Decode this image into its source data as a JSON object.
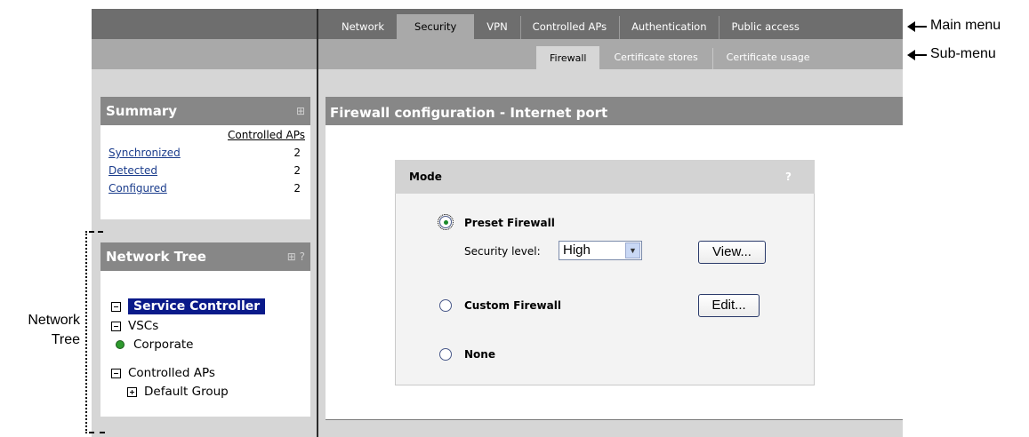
{
  "main_menu": {
    "tabs": [
      {
        "label": "Network",
        "active": false
      },
      {
        "label": "Security",
        "active": true
      },
      {
        "label": "VPN",
        "active": false
      },
      {
        "label": "Controlled APs",
        "active": false
      },
      {
        "label": "Authentication",
        "active": false
      },
      {
        "label": "Public access",
        "active": false
      }
    ]
  },
  "sub_menu": {
    "tabs": [
      {
        "label": "Firewall",
        "active": true
      },
      {
        "label": "Certificate stores",
        "active": false
      },
      {
        "label": "Certificate usage",
        "active": false
      }
    ]
  },
  "annotations": {
    "main_menu": "Main menu",
    "sub_menu": "Sub-menu",
    "network_tree_line1": "Network",
    "network_tree_line2": "Tree"
  },
  "summary": {
    "title": "Summary",
    "column_header": "Controlled APs",
    "rows": [
      {
        "label": "Synchronized",
        "value": "2"
      },
      {
        "label": "Detected",
        "value": "2"
      },
      {
        "label": "Configured",
        "value": "2"
      }
    ]
  },
  "network_tree": {
    "title": "Network Tree",
    "help": "?",
    "root": "Service Controller",
    "vscs": "VSCs",
    "corporate": "Corporate",
    "controlled_aps": "Controlled APs",
    "default_group": "Default Group"
  },
  "firewall": {
    "title": "Firewall configuration - Internet port",
    "mode_title": "Mode",
    "help": "?",
    "preset_label": "Preset Firewall",
    "security_level_label": "Security level:",
    "security_level_value": "High",
    "view_button": "View...",
    "custom_label": "Custom Firewall",
    "edit_button": "Edit...",
    "none_label": "None",
    "selected_mode": "Preset Firewall"
  },
  "colors": {
    "top_bar": "#6e6e6e",
    "sub_bar": "#a9a9a9",
    "panel_header": "#878787",
    "tree_selected": "#0a1a8a",
    "status_green": "#2e9a2e"
  }
}
